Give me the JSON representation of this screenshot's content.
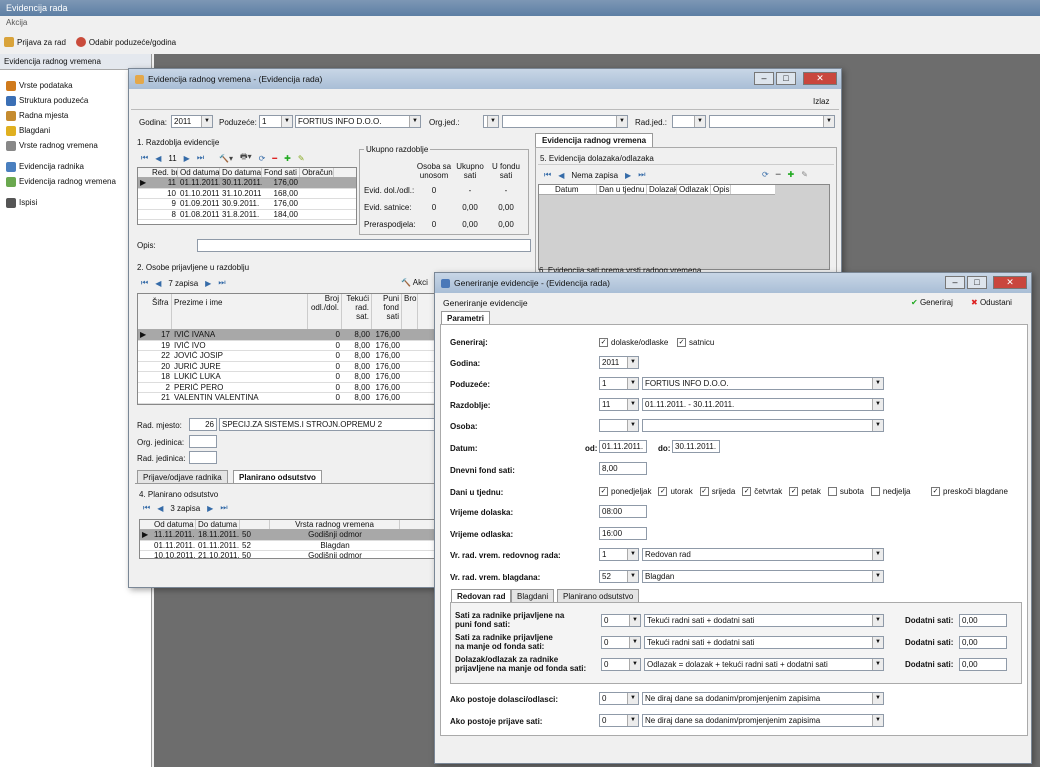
{
  "app": {
    "title": "Evidencija rada",
    "menu": "Akcija",
    "toolbar": [
      "Prijava za rad",
      "Odabir poduzeće/godina"
    ]
  },
  "sidebar": {
    "header": "Evidencija radnog vremena",
    "items": [
      {
        "label": "Vrste podataka",
        "color": "#d07a1c"
      },
      {
        "label": "Struktura poduzeća",
        "color": "#3b6fb5"
      },
      {
        "label": "Radna mjesta",
        "color": "#c58b2f"
      },
      {
        "label": "Blagdani",
        "color": "#e0b020"
      },
      {
        "label": "Vrste radnog vremena",
        "color": "#888"
      },
      {
        "label": "Evidencija radnika",
        "color": "#4a7fbf"
      },
      {
        "label": "Evidencija radnog vremena",
        "color": "#6aa84f"
      },
      {
        "label": "Ispisi",
        "color": "#555"
      }
    ]
  },
  "w1": {
    "title": "Evidencija radnog vremena - (Evidencija rada)",
    "izlaz": "Izlaz",
    "godina_label": "Godina:",
    "godina": "2011",
    "poduzece_label": "Poduzeće:",
    "poduzece": "1",
    "poduzece_name": "FORTIUS INFO D.O.O.",
    "orgjed_label": "Org.jed.:",
    "radjed_label": "Rad.jed.:",
    "sec1": "1. Razdoblja evidencije",
    "nav1": "11",
    "razd_cols": [
      "Red. br.",
      "Od datuma",
      "Do datuma",
      "Fond sati",
      "Obračun"
    ],
    "razd_rows": [
      [
        "11",
        "01.11.2011.",
        "30.11.2011.",
        "176,00"
      ],
      [
        "10",
        "01.10.2011.",
        "31.10.2011.",
        "168,00"
      ],
      [
        "9",
        "01.09.2011.",
        "30.9.2011.",
        "176,00"
      ],
      [
        "8",
        "01.08.2011.",
        "31.8.2011.",
        "184,00"
      ]
    ],
    "ukupno": "Ukupno razdoblje",
    "uk_cols": [
      "Osoba sa unosom",
      "Ukupno sati",
      "U fondu sati"
    ],
    "uk_rows": [
      [
        "Evid. dol./odl.:",
        "0",
        "-",
        "-"
      ],
      [
        "Evid. satnice:",
        "0",
        "0,00",
        "0,00"
      ],
      [
        "Preraspodjela:",
        "0",
        "0,00",
        "0,00"
      ]
    ],
    "opis": "Opis:",
    "tab_right": "Evidencija radnog vremena",
    "sec5": "5. Evidencija dolazaka/odlazaka",
    "nav5": "Nema zapisa",
    "dol_cols": [
      "Datum",
      "Dan u tjednu",
      "Dolazak",
      "Odlazak",
      "Opis"
    ],
    "sec6": "6. Evidencija sati prema vrsti radnog vremena",
    "sec2": "2. Osobe prijavljene u razdoblju",
    "nav2": "7 zapisa",
    "akcija": "Akci",
    "os_cols": [
      "Šifra",
      "Prezime i ime",
      "Broj odl./dol.",
      "Tekući rad. sat.",
      "Puni fond sati",
      "Bro"
    ],
    "os_rows": [
      [
        "17",
        "IVIĆ IVANA",
        "0",
        "8,00",
        "176,00"
      ],
      [
        "19",
        "IVIĆ IVO",
        "0",
        "8,00",
        "176,00"
      ],
      [
        "22",
        "JOVIĆ JOSIP",
        "0",
        "8,00",
        "176,00"
      ],
      [
        "20",
        "JURIĆ JURE",
        "0",
        "8,00",
        "176,00"
      ],
      [
        "18",
        "LUKIĆ LUKA",
        "0",
        "8,00",
        "176,00"
      ],
      [
        "2",
        "PERIĆ PERO",
        "0",
        "8,00",
        "176,00"
      ],
      [
        "21",
        "VALENTIN VALENTINA",
        "0",
        "8,00",
        "176,00"
      ]
    ],
    "rad_mjesto_label": "Rad. mjesto:",
    "rad_mjesto_id": "26",
    "rad_mjesto": "SPECIJ.ZA SISTEMS.I STROJN.OPREMU 2",
    "org_label": "Org. jedinica:",
    "radj_label": "Rad. jedinica:",
    "tabs_bottom": [
      "Prijave/odjave radnika",
      "Planirano odsutstvo"
    ],
    "sec4": "4. Planirano odsutstvo",
    "nav4": "3 zapisa",
    "ods_cols": [
      "Od datuma",
      "Do datuma",
      "",
      "Vrsta radnog vremena"
    ],
    "ods_rows": [
      [
        "11.11.2011.",
        "18.11.2011.",
        "50",
        "Godišnji odmor"
      ],
      [
        "01.11.2011.",
        "01.11.2011.",
        "52",
        "Blagdan"
      ],
      [
        "10.10.2011.",
        "21.10.2011.",
        "50",
        "Godišnji odmor"
      ]
    ]
  },
  "w2": {
    "title": "Generiranje evidencije - (Evidencija rada)",
    "header": "Generiranje evidencije",
    "generiraj": "Generiraj",
    "odustani": "Odustani",
    "tab": "Parametri",
    "generiraj_label": "Generiraj:",
    "cb_dol": "dolaske/odlaske",
    "cb_sat": "satnicu",
    "godina_label": "Godina:",
    "godina": "2011",
    "poduzece_label": "Poduzeće:",
    "poduzece": "1",
    "poduzece_name": "FORTIUS INFO D.O.O.",
    "razdoblje_label": "Razdoblje:",
    "razdoblje": "11",
    "razdoblje_name": "01.11.2011. - 30.11.2011.",
    "osoba_label": "Osoba:",
    "datum_label": "Datum:",
    "od": "od:",
    "od_val": "01.11.2011.",
    "do": "do:",
    "do_val": "30.11.2011.",
    "fond_label": "Dnevni fond sati:",
    "fond": "8,00",
    "dani_label": "Dani u tjednu:",
    "dani": [
      {
        "l": "ponedjeljak",
        "c": true
      },
      {
        "l": "utorak",
        "c": true
      },
      {
        "l": "srijeda",
        "c": true
      },
      {
        "l": "četvrtak",
        "c": true
      },
      {
        "l": "petak",
        "c": true
      },
      {
        "l": "subota",
        "c": false
      },
      {
        "l": "nedjelja",
        "c": false
      }
    ],
    "blagdane": "preskoči blagdane",
    "vd_label": "Vrijeme dolaska:",
    "vd": "08:00",
    "vo_label": "Vrijeme odlaska:",
    "vo": "16:00",
    "vrrr_label": "Vr. rad. vrem. redovnog rada:",
    "vrrr": "1",
    "vrrr_name": "Redovan rad",
    "vrb_label": "Vr. rad. vrem. blagdana:",
    "vrb": "52",
    "vrb_name": "Blagdan",
    "subtabs": [
      "Redovan rad",
      "Blagdani",
      "Planirano odsutstvo"
    ],
    "rows": [
      {
        "l1": "Sati za radnike prijavljene na",
        "l2": "puni fond sati:",
        "v": "0",
        "opt": "Tekući radni sati + dodatni sati",
        "dl": "Dodatni sati:",
        "dv": "0,00"
      },
      {
        "l1": "Sati za radnike prijavljene",
        "l2": "na manje od fonda sati:",
        "v": "0",
        "opt": "Tekući radni sati + dodatni sati",
        "dl": "Dodatni sati:",
        "dv": "0,00"
      },
      {
        "l1": "Dolazak/odlazak za radnike",
        "l2": "prijavljene na manje od fonda sati:",
        "v": "0",
        "opt": "Odlazak = dolazak + tekući radni sati + dodatni sati",
        "dl": "Dodatni sati:",
        "dv": "0,00"
      }
    ],
    "apd_label": "Ako postoje dolasci/odlasci:",
    "apd": "0",
    "apd_opt": "Ne diraj dane sa dodanim/promjenjenim zapisima",
    "aps_label": "Ako postoje prijave sati:",
    "aps": "0",
    "aps_opt": "Ne diraj dane sa dodanim/promjenjenim zapisima"
  }
}
